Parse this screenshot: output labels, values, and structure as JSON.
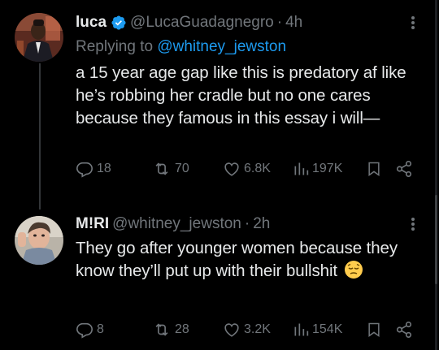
{
  "tweets": [
    {
      "name": "luca",
      "verified": true,
      "handle": "@LucaGuadagnegro",
      "separator": "·",
      "time": "4h",
      "reply_prefix": "Replying to",
      "reply_mention": "@whitney_jewston",
      "text": "a 15 year age gap like this is predatory af like he’s robbing her cradle but no one cares because they famous in this essay i will—",
      "stats": {
        "replies": "18",
        "retweets": "70",
        "likes": "6.8K",
        "views": "197K"
      }
    },
    {
      "name": "M!RI",
      "handle": "@whitney_jewston",
      "separator": "·",
      "time": "2h",
      "text": "They go after younger women because they know they’ll put up with their bullshit",
      "emoji": "pensive-face",
      "stats": {
        "replies": "8",
        "retweets": "28",
        "likes": "3.2K",
        "views": "154K"
      }
    }
  ],
  "colors": {
    "background": "#000000",
    "text": "#e7e9ea",
    "secondary": "#71767b",
    "link": "#1d9bf0",
    "verified": "#1d9bf0"
  },
  "icons": [
    "more-icon",
    "verified-badge-icon",
    "reply-icon",
    "retweet-icon",
    "like-icon",
    "views-icon",
    "bookmark-icon",
    "share-icon"
  ]
}
